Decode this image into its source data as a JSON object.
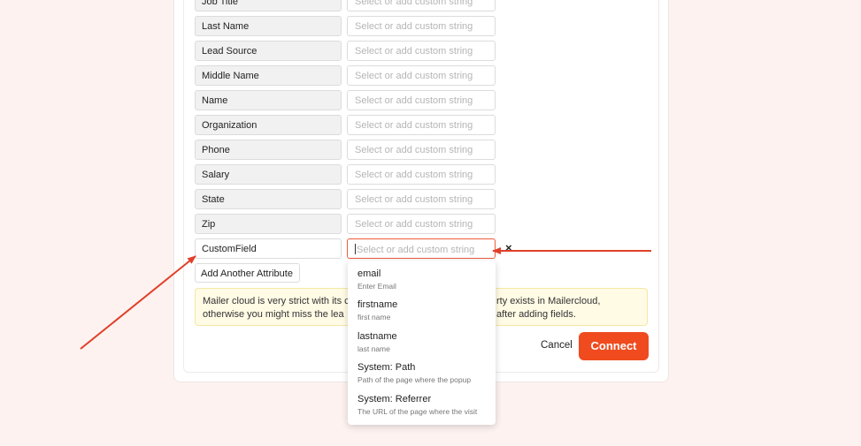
{
  "rows": [
    {
      "key": "Job Title",
      "placeholder": "Select or add custom string"
    },
    {
      "key": "Last Name",
      "placeholder": "Select or add custom string"
    },
    {
      "key": "Lead Source",
      "placeholder": "Select or add custom string"
    },
    {
      "key": "Middle Name",
      "placeholder": "Select or add custom string"
    },
    {
      "key": "Name",
      "placeholder": "Select or add custom string"
    },
    {
      "key": "Organization",
      "placeholder": "Select or add custom string"
    },
    {
      "key": "Phone",
      "placeholder": "Select or add custom string"
    },
    {
      "key": "Salary",
      "placeholder": "Select or add custom string"
    },
    {
      "key": "State",
      "placeholder": "Select or add custom string"
    },
    {
      "key": "Zip",
      "placeholder": "Select or add custom string"
    }
  ],
  "custom_row": {
    "key": "CustomField",
    "placeholder": "Select or add custom string",
    "remove_label": "×"
  },
  "add_attribute_label": "Add Another Attribute",
  "notice": {
    "line1_left": "Mailer cloud is very strict with its c",
    "line1_right": "rty exists in Mailercloud,",
    "line2_left": "otherwise you might miss the lea",
    "line2_right": "after adding fields."
  },
  "cancel_label": "Cancel",
  "connect_label": "Connect",
  "dropdown_items": [
    {
      "label": "email",
      "desc": "Enter Email"
    },
    {
      "label": "firstname",
      "desc": "first name"
    },
    {
      "label": "lastname",
      "desc": "last name"
    },
    {
      "label": "System: Path",
      "desc": "Path of the page where the popup"
    },
    {
      "label": "System: Referrer",
      "desc": "The URL of the page where the visit"
    }
  ],
  "colors": {
    "accent": "#ef4b1f",
    "arrow": "#e0402a",
    "background": "#fdf2ef",
    "notice_bg": "#fffbe5"
  }
}
